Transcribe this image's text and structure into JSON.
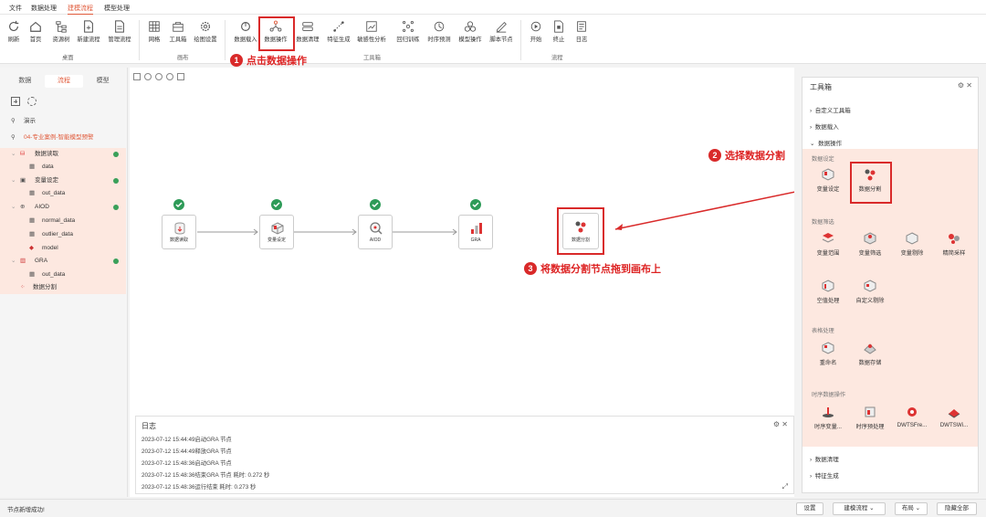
{
  "menu": {
    "items": [
      "文件",
      "数据处理",
      "建模流程",
      "模型处理"
    ],
    "active_index": 2
  },
  "toolbar": {
    "buttons": [
      "刷新",
      "首页",
      "资源树",
      "新建流程",
      "管理流程",
      "网格",
      "工具箱",
      "绘图设置",
      "数据载入",
      "数据操作",
      "数据清理",
      "特征生成",
      "敏感性分析",
      "回归训练",
      "时序预测",
      "模型操作",
      "脚本节点",
      "开始",
      "终止",
      "日志"
    ],
    "groups": [
      "桌面",
      "画布",
      "工具箱",
      "流程"
    ]
  },
  "annotations": {
    "step1_number": "1",
    "step1_text": "点击数据操作",
    "step2_number": "2",
    "step2_text": "选择数据分割",
    "step3_number": "3",
    "step3_text": "将数据分割节点拖到画布上"
  },
  "left_panel": {
    "tabs": [
      "数据",
      "流程",
      "模型"
    ],
    "active_tab": 1,
    "tree": {
      "demo": "演示",
      "project": "04-专业案例-智能模型预警",
      "items": [
        "数据读取",
        "data",
        "变量设定",
        "out_data",
        "AIOD",
        "normal_data",
        "outlier_data",
        "model",
        "GRA",
        "out_data",
        "数据分割"
      ]
    }
  },
  "canvas": {
    "nodes": [
      "数据读取",
      "变量设定",
      "AIOD",
      "GRA",
      "数据分割"
    ]
  },
  "log": {
    "title": "日志",
    "lines": [
      "2023-07-12 15:44:49启动GRA 节点",
      "2023-07-12 15:44:49释放GRA 节点",
      "2023-07-12 15:48:36启动GRA 节点",
      "2023-07-12 15:48:36结束GRA 节点 耗时:  0.272 秒",
      "2023-07-12 15:48:36运行结束 耗时:  0.273 秒"
    ]
  },
  "toolbox": {
    "title": "工具箱",
    "sections": [
      "自定义工具箱",
      "数据载入",
      "数据操作"
    ],
    "bottom_sections": [
      "数据清理",
      "特征生成"
    ],
    "groups": {
      "data_setting": {
        "label": "数据设定",
        "tools": [
          "变量设定",
          "数据分割"
        ]
      },
      "data_filter": {
        "label": "数据筛选",
        "tools": [
          "变量范围",
          "变量筛选",
          "变量剔除",
          "精简采样",
          "空值处理",
          "自定义剔除"
        ]
      },
      "table_ops": {
        "label": "表格处理",
        "tools": [
          "重命名",
          "数据存储"
        ]
      },
      "ts_ops": {
        "label": "时序数据操作",
        "tools": [
          "时序变量...",
          "时序预处理",
          "DWTSFre...",
          "DWTSWi..."
        ]
      }
    }
  },
  "status": {
    "message": "节点新增成功!",
    "buttons": [
      "设置",
      "建模流程",
      "布局",
      "隐藏全部"
    ]
  },
  "colors": {
    "accent": "#e05a3a",
    "annotation_red": "#d92a2a",
    "success": "#2e9b58",
    "highlight_bg": "#fde8e0"
  }
}
